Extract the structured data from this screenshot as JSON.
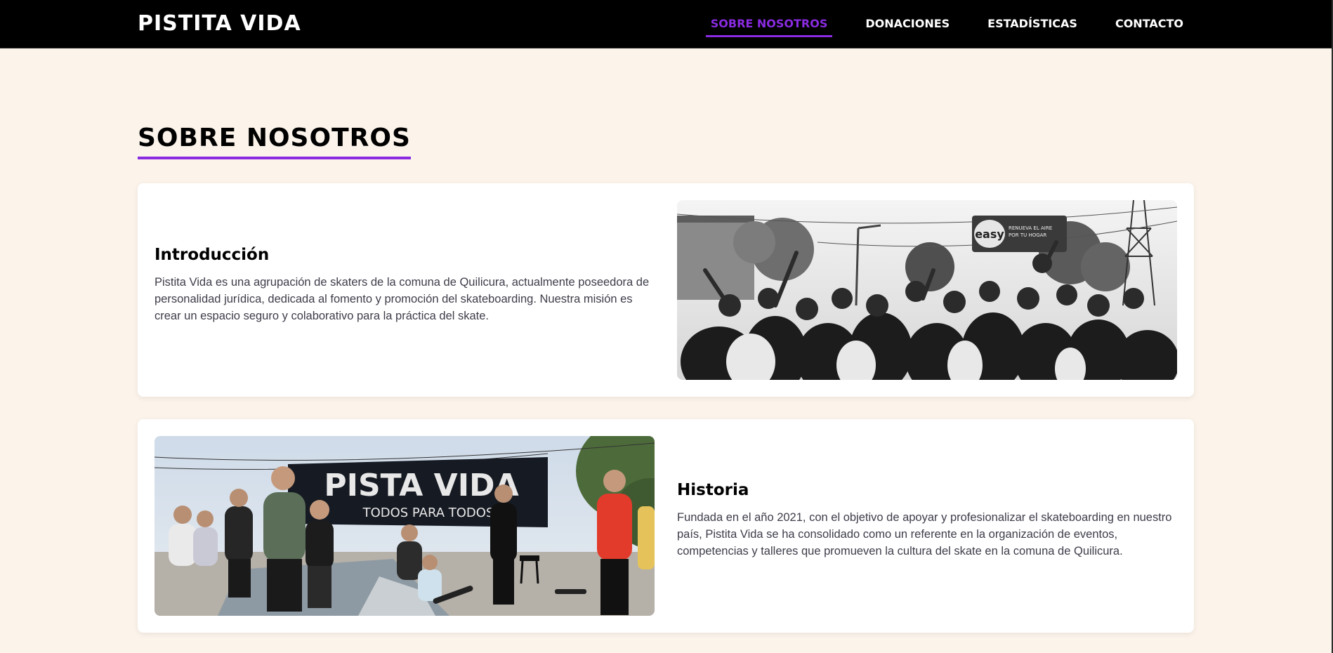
{
  "brand": {
    "name": "PISTITA VIDA"
  },
  "nav": {
    "items": [
      {
        "label": "SOBRE NOSOTROS",
        "active": true
      },
      {
        "label": "DONACIONES",
        "active": false
      },
      {
        "label": "ESTADÍSTICAS",
        "active": false
      },
      {
        "label": "CONTACTO",
        "active": false
      }
    ]
  },
  "section": {
    "title": "SOBRE NOSOTROS"
  },
  "cards": [
    {
      "heading": "Introducción",
      "body": "Pistita Vida es una agrupación de skaters de la comuna de Quilicura, actualmente poseedora de personalidad jurídica, dedicada al fomento y promoción del skateboarding. Nuestra misión es crear un espacio seguro y colaborativo para la práctica del skate.",
      "image": {
        "sign_text": "easy",
        "sign_subtext": "RENUEVA EL AIRE POR TU HOGAR"
      }
    },
    {
      "heading": "Historia",
      "body": "Fundada en el año 2021, con el objetivo de apoyar y profesionalizar el skateboarding en nuestro país, Pistita Vida se ha consolidado como un referente en la organización de eventos, competencias y talleres que promueven la cultura del skate en la comuna de Quilicura.",
      "image": {
        "banner_text": "PISTA VIDA",
        "banner_subtext": "TODOS PARA TODOS"
      }
    }
  ],
  "colors": {
    "accent": "#8a2be2",
    "background": "#fcf4eb",
    "navbar": "#000000",
    "card": "#ffffff"
  }
}
